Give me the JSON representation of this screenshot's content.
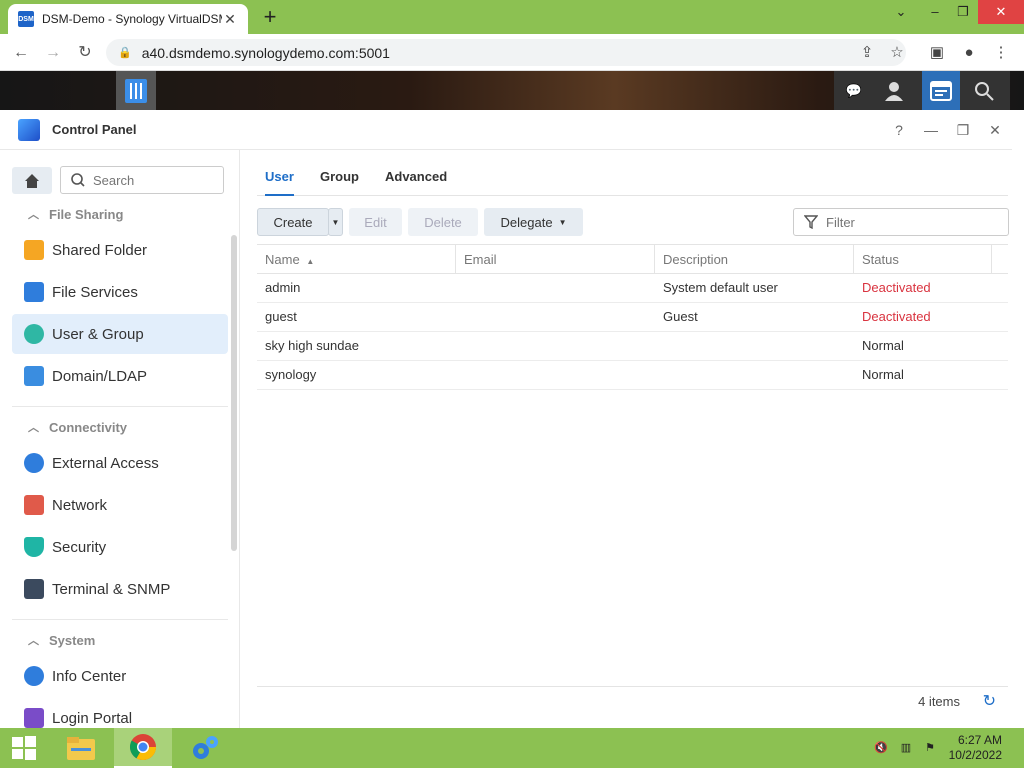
{
  "browser": {
    "tab_title": "DSM-Demo - Synology VirtualDSM",
    "tab_favicon": "DSM",
    "url": "a40.dsmdemo.synologydemo.com:5001",
    "new_tab": "+",
    "window_controls": {
      "minimize": "‒",
      "restore": "❐",
      "close": "✕"
    }
  },
  "control_panel": {
    "title": "Control Panel",
    "help": "?",
    "minimize": "—",
    "restore": "❐",
    "close": "✕"
  },
  "sidebar": {
    "search_placeholder": "Search",
    "sections": [
      {
        "label": "File Sharing",
        "items": [
          "Shared Folder",
          "File Services",
          "User & Group",
          "Domain/LDAP"
        ]
      },
      {
        "label": "Connectivity",
        "items": [
          "External Access",
          "Network",
          "Security",
          "Terminal & SNMP"
        ]
      },
      {
        "label": "System",
        "items": [
          "Info Center",
          "Login Portal"
        ]
      }
    ],
    "active_item": "User & Group"
  },
  "tabs": [
    "User",
    "Group",
    "Advanced"
  ],
  "active_tab": "User",
  "toolbar": {
    "create": "Create",
    "edit": "Edit",
    "delete": "Delete",
    "delegate": "Delegate",
    "filter_placeholder": "Filter"
  },
  "table": {
    "columns": [
      "Name",
      "Email",
      "Description",
      "Status"
    ],
    "sort_column": "Name",
    "rows": [
      {
        "name": "admin",
        "email": "",
        "description": "System default user",
        "status": "Deactivated"
      },
      {
        "name": "guest",
        "email": "",
        "description": "Guest",
        "status": "Deactivated"
      },
      {
        "name": "sky high sundae",
        "email": "",
        "description": "",
        "status": "Normal"
      },
      {
        "name": "synology",
        "email": "",
        "description": "",
        "status": "Normal"
      }
    ]
  },
  "footer": {
    "count": "4 items"
  },
  "taskbar": {
    "time": "6:27 AM",
    "date": "10/2/2022"
  },
  "colors": {
    "accent": "#1e6ec8",
    "deactivated": "#d9333f",
    "taskbar": "#8cc152"
  }
}
